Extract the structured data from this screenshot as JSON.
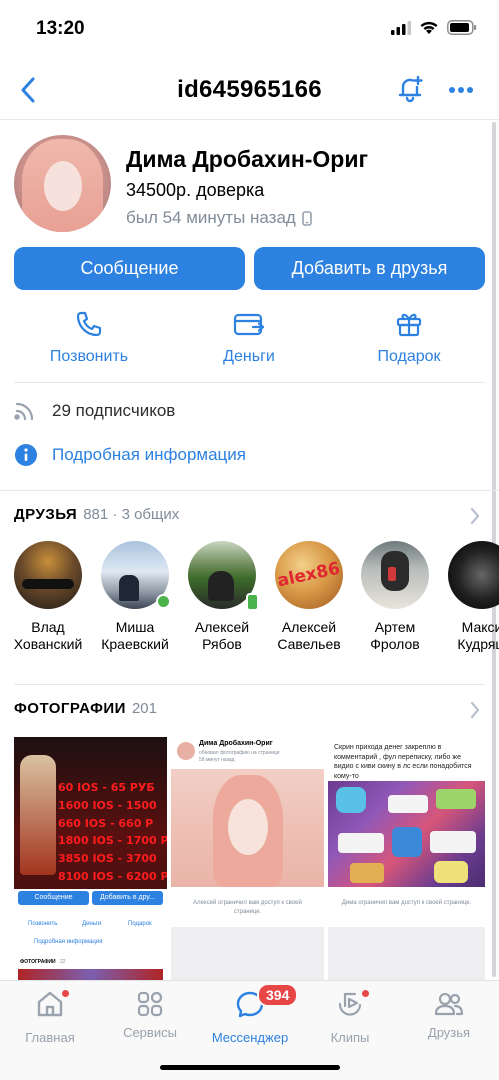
{
  "status_bar": {
    "time": "13:20"
  },
  "nav": {
    "title": "id645965166"
  },
  "profile": {
    "name": "Дима Дробахин-Ориг",
    "status": "34500р. доверка",
    "last_seen": "был 54 минуты назад"
  },
  "buttons": {
    "message": "Сообщение",
    "add_friend": "Добавить в друзья"
  },
  "actions": [
    {
      "label": "Позвонить",
      "icon": "phone-icon"
    },
    {
      "label": "Деньги",
      "icon": "money-icon"
    },
    {
      "label": "Подарок",
      "icon": "gift-icon"
    }
  ],
  "info": {
    "followers": "29 подписчиков",
    "details": "Подробная информация"
  },
  "friends": {
    "title": "ДРУЗЬЯ",
    "count": "881 · 3 общих",
    "items": [
      {
        "name": "Влад\nХованский"
      },
      {
        "name": "Миша\nКраевский"
      },
      {
        "name": "Алексей\nРябов"
      },
      {
        "name": "Алексей\nСавельев",
        "avatar_text": "alex86"
      },
      {
        "name": "Артем\nФролов"
      },
      {
        "name": "Макси\nКудряш"
      }
    ]
  },
  "photos": {
    "title": "ФОТОГРАФИИ",
    "count": "201",
    "p1": {
      "lines": [
        "60 IOS - 65 РУБ",
        "1600 IOS - 1500",
        "660 IOS - 660 Р",
        "1800 IOS - 1700 Р",
        "3850 IOS - 3700",
        "8100 IOS - 6200 Р"
      ],
      "mini_btn1": "Сообщение",
      "mini_btn2": "Добавить в дру...",
      "mini_actions": [
        "Позвонить",
        "Деньги",
        "Подарок"
      ],
      "mini_info": "Подробная информация",
      "mini_photos": "ФОТОГРАФИИ",
      "mini_photos_count": "22"
    },
    "p2": {
      "author": "Дима Дробахин-Ориг",
      "sub": "обновил фотографию на странице",
      "time": "59 минут назад",
      "restricted": "Алексей ограничил вам доступ к своей странице."
    },
    "p3": {
      "caption": "Скрин прихода денег закреплю в комментарий , фул переписку, либо же видио с киви скину в лс если понадобится кому-то",
      "restricted": "Дима ограничил вам доступ к своей странице."
    }
  },
  "tabbar": {
    "items": [
      {
        "label": "Главная"
      },
      {
        "label": "Сервисы"
      },
      {
        "label": "Мессенджер",
        "badge": "394"
      },
      {
        "label": "Клипы"
      },
      {
        "label": "Друзья"
      }
    ]
  },
  "colors": {
    "accent": "#2d81e0",
    "secondary_text": "#818c99",
    "online": "#4bb34b",
    "badge": "#e64646"
  }
}
